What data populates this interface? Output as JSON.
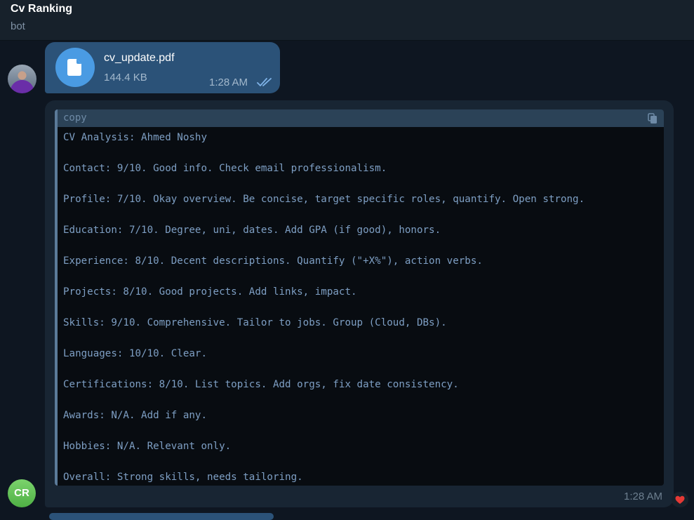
{
  "header": {
    "title": "Cv Ranking",
    "subtitle": "bot"
  },
  "file_message": {
    "file_name": "cv_update.pdf",
    "file_size": "144.4 KB",
    "time": "1:28 AM",
    "status_icon": "double-check-icon",
    "file_icon": "document-icon"
  },
  "bot_message": {
    "code_language": "copy",
    "lines": [
      "CV Analysis: Ahmed Noshy",
      "Contact: 9/10. Good info. Check email professionalism.",
      "Profile: 7/10. Okay overview. Be concise, target specific roles, quantify. Open strong.",
      "Education: 7/10. Degree, uni, dates. Add GPA (if good), honors.",
      "Experience: 8/10. Decent descriptions. Quantify (\"+X%\"), action verbs.",
      "Projects: 8/10. Good projects. Add links, impact.",
      "Skills: 9/10. Comprehensive. Tailor to jobs. Group (Cloud, DBs).",
      "Languages: 10/10. Clear.",
      "Certifications: 8/10. List topics. Add orgs, fix date consistency.",
      "Awards: N/A. Add if any.",
      "Hobbies: N/A. Relevant only.",
      "Overall: Strong skills, needs tailoring."
    ],
    "time": "1:28 AM",
    "reaction": "heart-icon"
  },
  "bot_avatar": {
    "initials": "CR"
  },
  "colors": {
    "background": "#0e1621",
    "header": "#17212b",
    "outgoing_bubble": "#2b5278",
    "incoming_bubble": "#182533",
    "code_text": "#7e9fc4",
    "accent": "#4a9be3"
  }
}
